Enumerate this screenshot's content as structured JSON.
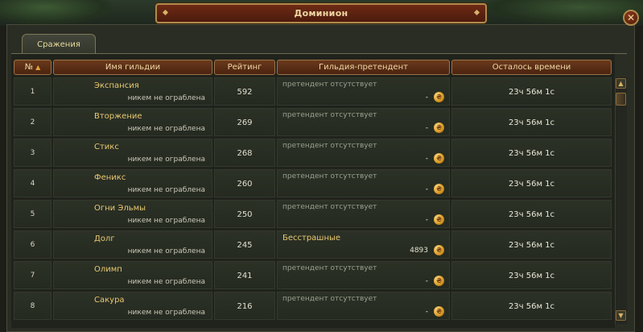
{
  "window": {
    "title": "Доминион",
    "close_icon": "✕"
  },
  "tabs": [
    {
      "label": "Сражения"
    }
  ],
  "columns": {
    "number": "№",
    "guild_name": "Имя гильдии",
    "rating": "Рейтинг",
    "challenger": "Гильдия-претендент",
    "time_left": "Осталось времени"
  },
  "rows": [
    {
      "num": "1",
      "name": "Экспансия",
      "status": "никем не ограблена",
      "rating": "592",
      "challenger": "претендент отсутствует",
      "bid": "-",
      "time": "23ч 56м 1с"
    },
    {
      "num": "2",
      "name": "Вторжение",
      "status": "никем не ограблена",
      "rating": "269",
      "challenger": "претендент отсутствует",
      "bid": "-",
      "time": "23ч 56м 1с"
    },
    {
      "num": "3",
      "name": "Стикс",
      "status": "никем не ограблена",
      "rating": "268",
      "challenger": "претендент отсутствует",
      "bid": "-",
      "time": "23ч 56м 1с"
    },
    {
      "num": "4",
      "name": "Феникс",
      "status": "никем не ограблена",
      "rating": "260",
      "challenger": "претендент отсутствует",
      "bid": "-",
      "time": "23ч 56м 1с"
    },
    {
      "num": "5",
      "name": "Огни Эльмы",
      "status": "никем не ограблена",
      "rating": "250",
      "challenger": "претендент отсутствует",
      "bid": "-",
      "time": "23ч 56м 1с"
    },
    {
      "num": "6",
      "name": "Долг",
      "status": "никем не ограблена",
      "rating": "245",
      "challenger": "Бесстрашные",
      "bid": "4893",
      "time": "23ч 56м 1с"
    },
    {
      "num": "7",
      "name": "Олимп",
      "status": "никем не ограблена",
      "rating": "241",
      "challenger": "претендент отсутствует",
      "bid": "-",
      "time": "23ч 56м 1с"
    },
    {
      "num": "8",
      "name": "Сакура",
      "status": "никем не ограблена",
      "rating": "216",
      "challenger": "претендент отсутствует",
      "bid": "-",
      "time": "23ч 56м 1с"
    }
  ],
  "colors": {
    "accent_gold": "#e8c872",
    "header_brown": "#6b3a1d"
  }
}
